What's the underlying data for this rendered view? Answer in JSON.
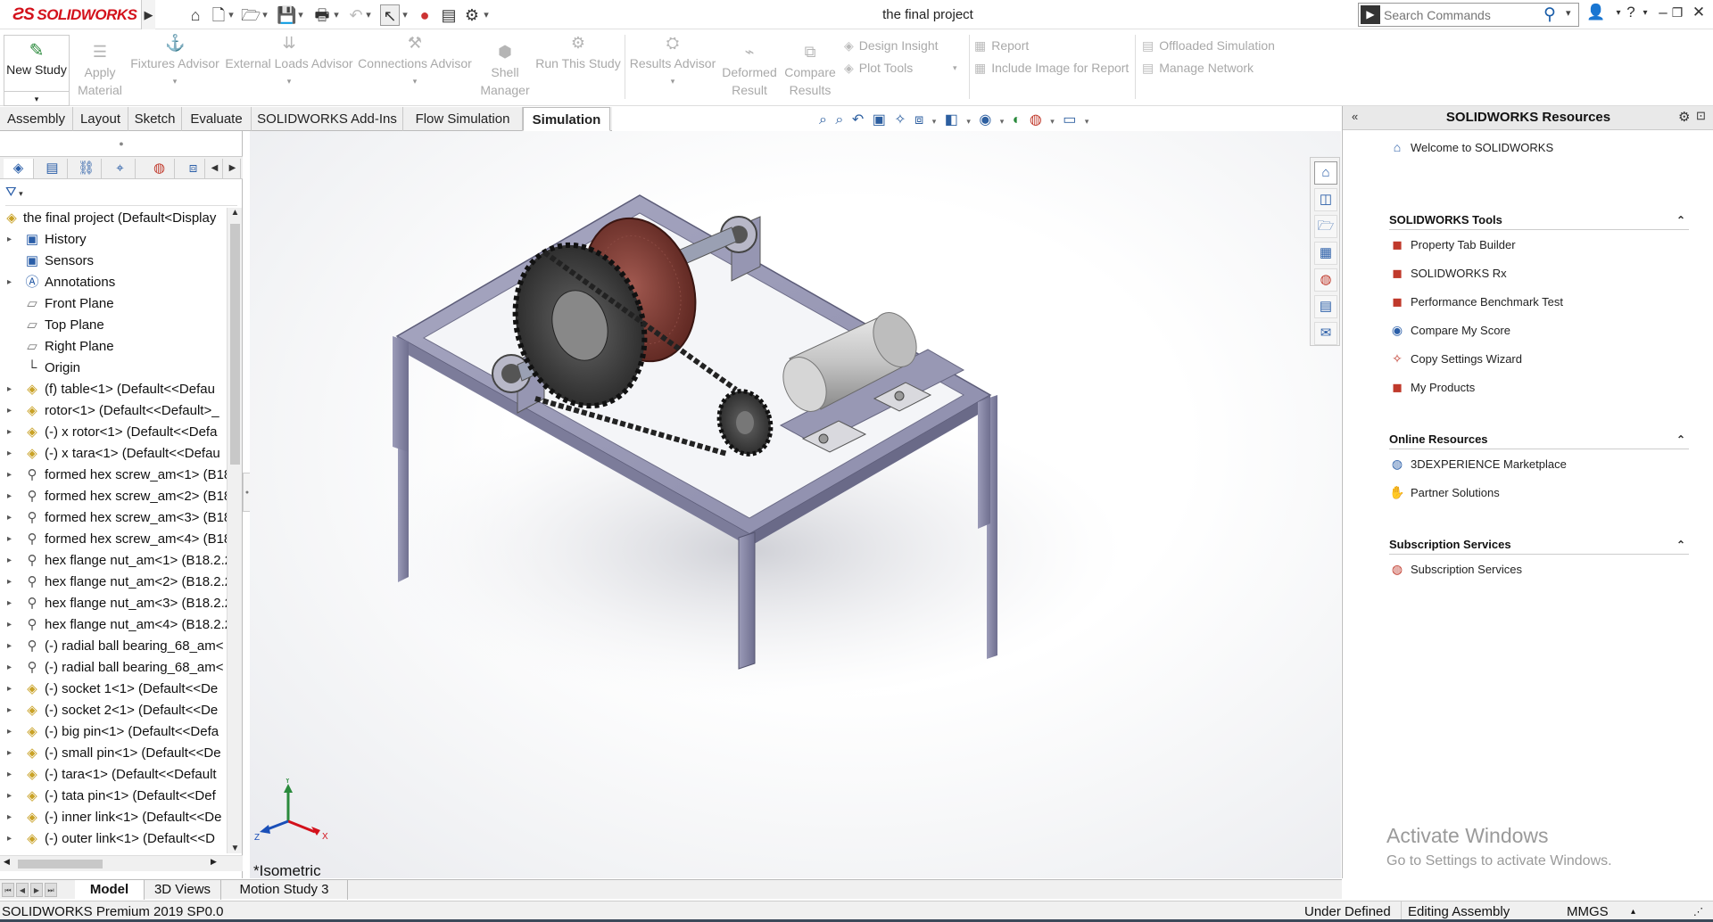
{
  "app": {
    "brand": "SOLIDWORKS",
    "title": "the final project"
  },
  "quick_access": [
    "home-icon",
    "new-doc-icon",
    "open-icon",
    "save-icon",
    "print-icon",
    "undo-icon",
    "select-icon",
    "traffic-light-icon",
    "file-properties-icon",
    "options-gear-icon"
  ],
  "search": {
    "placeholder": "Search Commands"
  },
  "ribbon": {
    "new_study": "New Study",
    "apply_material": [
      "Apply",
      "Material"
    ],
    "fixtures_advisor": "Fixtures Advisor",
    "external_loads_advisor": "External Loads Advisor",
    "connections_advisor": "Connections Advisor",
    "shell_manager": [
      "Shell",
      "Manager"
    ],
    "run_this_study": "Run This Study",
    "results_advisor": "Results Advisor",
    "deformed_result": [
      "Deformed",
      "Result"
    ],
    "compare_results": [
      "Compare",
      "Results"
    ],
    "design_insight": "Design Insight",
    "plot_tools": "Plot Tools",
    "report": "Report",
    "include_image_for_report": "Include Image for Report",
    "offloaded_simulation": "Offloaded Simulation",
    "manage_network": "Manage Network"
  },
  "command_tabs": [
    "Assembly",
    "Layout",
    "Sketch",
    "Evaluate",
    "SOLIDWORKS Add-Ins",
    "Flow Simulation",
    "Simulation"
  ],
  "active_tab": "Simulation",
  "feature_tree": {
    "root": "the final project  (Default<Display",
    "items": [
      {
        "label": "History",
        "icon": "history-icon",
        "expand": true
      },
      {
        "label": "Sensors",
        "icon": "sensors-icon",
        "expand": false
      },
      {
        "label": "Annotations",
        "icon": "annotations-icon",
        "expand": true
      },
      {
        "label": "Front Plane",
        "icon": "plane-icon",
        "expand": false
      },
      {
        "label": "Top Plane",
        "icon": "plane-icon",
        "expand": false
      },
      {
        "label": "Right Plane",
        "icon": "plane-icon",
        "expand": false
      },
      {
        "label": "Origin",
        "icon": "origin-icon",
        "expand": false
      },
      {
        "label": "(f) table<1> (Default<<Defau",
        "icon": "part-icon",
        "expand": true
      },
      {
        "label": "rotor<1> (Default<<Default>_",
        "icon": "part-icon",
        "expand": true
      },
      {
        "label": "(-) x rotor<1> (Default<<Defa",
        "icon": "part-icon",
        "expand": true
      },
      {
        "label": "(-) x tara<1> (Default<<Defau",
        "icon": "part-icon",
        "expand": true
      },
      {
        "label": "formed hex screw_am<1> (B18",
        "icon": "toolbox-icon",
        "expand": true
      },
      {
        "label": "formed hex screw_am<2> (B18",
        "icon": "toolbox-icon",
        "expand": true
      },
      {
        "label": "formed hex screw_am<3> (B18",
        "icon": "toolbox-icon",
        "expand": true
      },
      {
        "label": "formed hex screw_am<4> (B18",
        "icon": "toolbox-icon",
        "expand": true
      },
      {
        "label": "hex flange nut_am<1> (B18.2.2",
        "icon": "toolbox-icon",
        "expand": true
      },
      {
        "label": "hex flange nut_am<2> (B18.2.2",
        "icon": "toolbox-icon",
        "expand": true
      },
      {
        "label": "hex flange nut_am<3> (B18.2.2",
        "icon": "toolbox-icon",
        "expand": true
      },
      {
        "label": "hex flange nut_am<4> (B18.2.2",
        "icon": "toolbox-icon",
        "expand": true
      },
      {
        "label": "(-) radial ball bearing_68_am<",
        "icon": "toolbox-icon",
        "expand": true
      },
      {
        "label": "(-) radial ball bearing_68_am<",
        "icon": "toolbox-icon",
        "expand": true
      },
      {
        "label": "(-) socket 1<1> (Default<<De",
        "icon": "part-icon",
        "expand": true
      },
      {
        "label": "(-) socket 2<1> (Default<<De",
        "icon": "part-icon",
        "expand": true
      },
      {
        "label": "(-) big pin<1> (Default<<Defa",
        "icon": "part-icon",
        "expand": true
      },
      {
        "label": "(-) small pin<1> (Default<<De",
        "icon": "part-icon",
        "expand": true
      },
      {
        "label": "(-) tara<1> (Default<<Default",
        "icon": "part-icon",
        "expand": true
      },
      {
        "label": "(-) tata pin<1> (Default<<Def",
        "icon": "part-icon",
        "expand": true
      },
      {
        "label": "(-) inner link<1> (Default<<De",
        "icon": "part-icon",
        "expand": true
      },
      {
        "label": "(-) outer link<1> (Default<<D",
        "icon": "part-icon",
        "expand": true
      }
    ]
  },
  "viewport": {
    "view_label": "*Isometric",
    "triad": {
      "x": "X",
      "y": "Y",
      "z": "Z"
    }
  },
  "resources_panel": {
    "title": "SOLIDWORKS Resources",
    "welcome": "Welcome to SOLIDWORKS",
    "sections": [
      {
        "title": "SOLIDWORKS Tools",
        "items": [
          "Property Tab Builder",
          "SOLIDWORKS Rx",
          "Performance Benchmark Test",
          "Compare My Score",
          "Copy Settings Wizard",
          "My Products"
        ]
      },
      {
        "title": "Online Resources",
        "items": [
          "3DEXPERIENCE Marketplace",
          "Partner Solutions"
        ]
      },
      {
        "title": "Subscription Services",
        "items": [
          "Subscription Services"
        ]
      }
    ]
  },
  "watermark": {
    "line1": "Activate Windows",
    "line2": "Go to Settings to activate Windows."
  },
  "bottom_tabs": [
    "Model",
    "3D Views",
    "Motion Study 3"
  ],
  "active_bottom_tab": "Model",
  "status": {
    "product": "SOLIDWORKS Premium 2019 SP0.0",
    "state": "Under Defined",
    "mode": "Editing Assembly",
    "units": "MMGS"
  },
  "colors": {
    "brand_red": "#d3111b",
    "accent_blue": "#2a5ea8",
    "frame": "#8a8aa3",
    "disc": "#7a3a33"
  }
}
